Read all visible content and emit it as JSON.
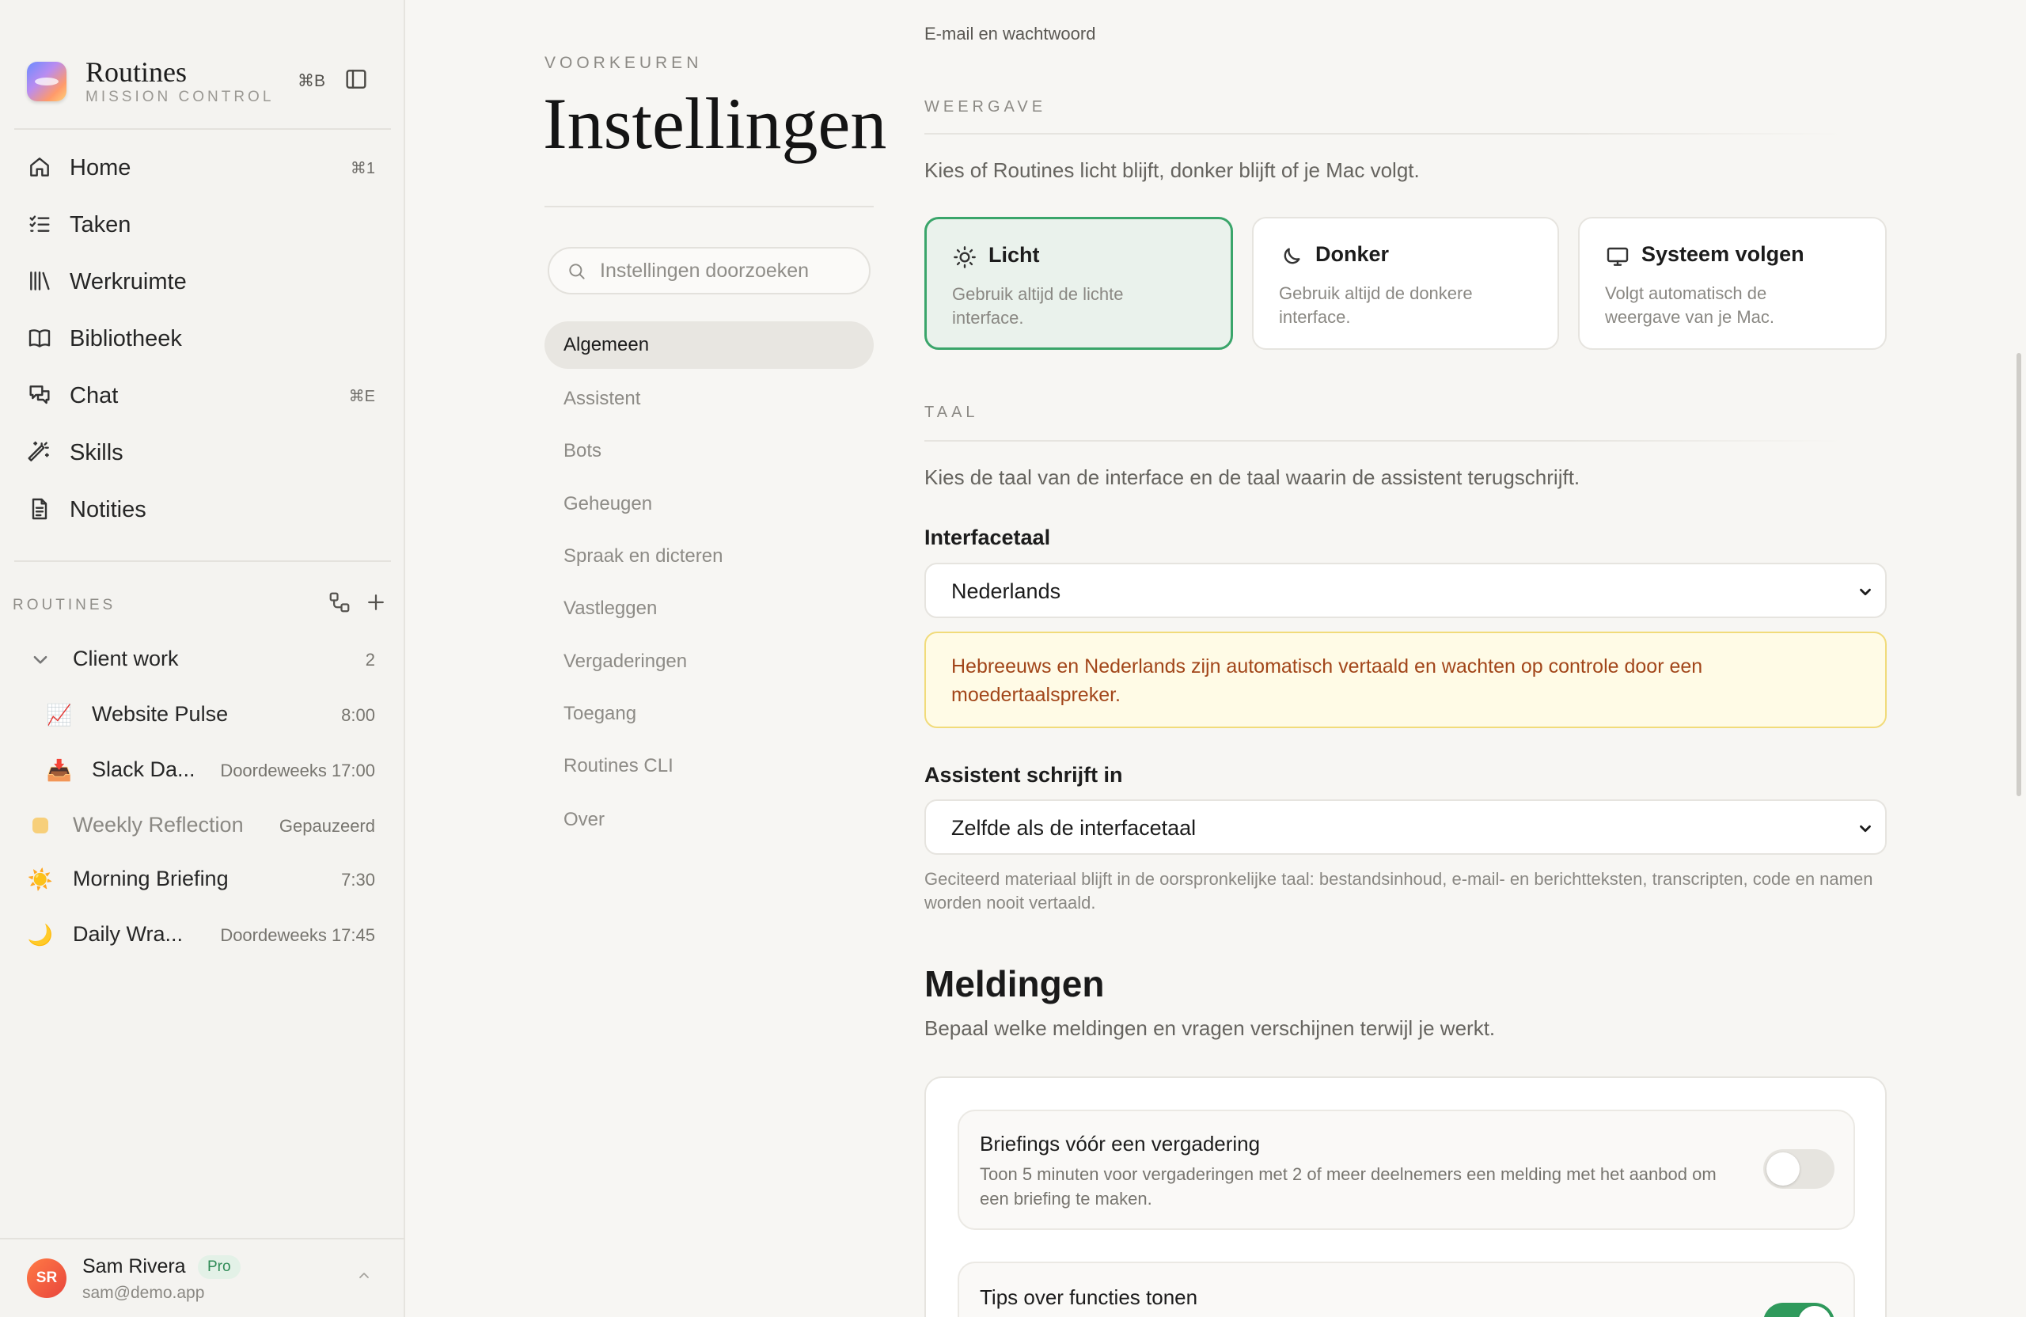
{
  "brand": {
    "title": "Routines",
    "subtitle": "MISSION CONTROL",
    "shortcut": "⌘B"
  },
  "nav": [
    {
      "label": "Home",
      "shortcut": "⌘1",
      "icon": "home-icon"
    },
    {
      "label": "Taken",
      "shortcut": "",
      "icon": "checklist-icon"
    },
    {
      "label": "Werkruimte",
      "shortcut": "",
      "icon": "library-icon"
    },
    {
      "label": "Bibliotheek",
      "shortcut": "",
      "icon": "book-icon"
    },
    {
      "label": "Chat",
      "shortcut": "⌘E",
      "icon": "chat-icon"
    },
    {
      "label": "Skills",
      "shortcut": "",
      "icon": "magic-wand-icon"
    },
    {
      "label": "Notities",
      "shortcut": "",
      "icon": "document-icon"
    }
  ],
  "routines": {
    "heading": "ROUTINES",
    "group": {
      "label": "Client work",
      "count": "2"
    },
    "items": [
      {
        "emoji": "📈",
        "name": "Website Pulse",
        "meta": "8:00"
      },
      {
        "emoji": "📥",
        "name": "Slack Da...",
        "meta": "Doordeweeks 17:00"
      },
      {
        "emoji": "",
        "name": "Weekly Reflection",
        "meta": "Gepauzeerd"
      },
      {
        "emoji": "☀️",
        "name": "Morning Briefing",
        "meta": "7:30"
      },
      {
        "emoji": "🌙",
        "name": "Daily Wra...",
        "meta": "Doordeweeks 17:45"
      }
    ]
  },
  "user": {
    "initials": "SR",
    "name": "Sam Rivera",
    "badge": "Pro",
    "email": "sam@demo.app"
  },
  "settings": {
    "eyebrow": "VOORKEUREN",
    "title": "Instellingen",
    "search_placeholder": "Instellingen doorzoeken",
    "nav": [
      "Algemeen",
      "Assistent",
      "Bots",
      "Geheugen",
      "Spraak en dicteren",
      "Vastleggen",
      "Vergaderingen",
      "Toegang",
      "Routines CLI",
      "Over"
    ],
    "active": "Algemeen"
  },
  "content": {
    "email_link": "E-mail en wachtwoord",
    "appearance": {
      "eyebrow": "WEERGAVE",
      "desc": "Kies of Routines licht blijft, donker blijft of je Mac volgt.",
      "options": [
        {
          "title": "Licht",
          "desc": "Gebruik altijd de lichte interface.",
          "icon": "sun-icon",
          "selected": true
        },
        {
          "title": "Donker",
          "desc": "Gebruik altijd de donkere interface.",
          "icon": "moon-icon",
          "selected": false
        },
        {
          "title": "Systeem volgen",
          "desc": "Volgt automatisch de weergave van je Mac.",
          "icon": "monitor-icon",
          "selected": false
        }
      ]
    },
    "language": {
      "eyebrow": "TAAL",
      "desc": "Kies de taal van de interface en de taal waarin de assistent terugschrijft.",
      "interface_label": "Interfacetaal",
      "interface_value": "Nederlands",
      "notice": "Hebreeuws en Nederlands zijn automatisch vertaald en wachten op controle door een moedertaalspreker.",
      "assistant_label": "Assistent schrijft in",
      "assistant_value": "Zelfde als de interfacetaal",
      "hint": "Geciteerd materiaal blijft in de oorspronkelijke taal: bestandsinhoud, e-mail- en berichtteksten, transcripten, code en namen worden nooit vertaald."
    },
    "notifications": {
      "title": "Meldingen",
      "desc": "Bepaal welke meldingen en vragen verschijnen terwijl je werkt.",
      "items": [
        {
          "title": "Briefings vóór een vergadering",
          "desc": "Toon 5 minuten voor vergaderingen met 2 of meer deelnemers een melding met het aanbod om een briefing te maken.",
          "enabled": false
        },
        {
          "title": "Tips over functies tonen",
          "desc": "",
          "enabled": true
        }
      ]
    }
  },
  "colors": {
    "accent": "#3aa56a",
    "notice_text": "#a2461a",
    "notice_bg": "#fffbe6"
  }
}
